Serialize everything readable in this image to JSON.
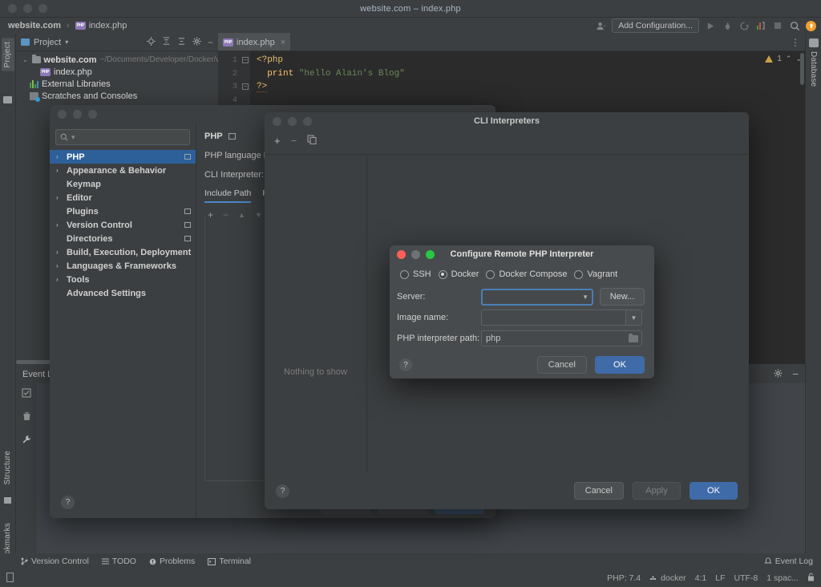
{
  "window": {
    "title": "website.com – index.php"
  },
  "navbar": {
    "project": "website.com",
    "separator": "›",
    "file": "index.php",
    "add_configuration": "Add Configuration...",
    "icons": [
      "profile-icon",
      "run-icon",
      "debug-icon",
      "run-coverage-icon",
      "profiler-icon",
      "stop-icon",
      "search-icon",
      "updates-icon"
    ]
  },
  "tool_windows": {
    "left_top": "Project",
    "left_bottom": [
      "Structure",
      "Bookmarks"
    ],
    "right": "Database"
  },
  "project_pane": {
    "title": "Project",
    "dropdown": "▾",
    "icons": [
      "locate-icon",
      "expand-all-icon",
      "collapse-all-icon",
      "settings-gear-icon",
      "hide-icon"
    ]
  },
  "project_tree": [
    {
      "label": "website.com",
      "path": "~/Documents/Developer/Docker/ww",
      "icon": "folder-icon",
      "arrow": "⌄",
      "bold": true,
      "indent": 0
    },
    {
      "label": "index.php",
      "path": "",
      "icon": "php-file-icon",
      "arrow": "",
      "bold": false,
      "indent": 1
    },
    {
      "label": "External Libraries",
      "path": "",
      "icon": "library-icon",
      "arrow": "",
      "bold": false,
      "indent": 0
    },
    {
      "label": "Scratches and Consoles",
      "path": "",
      "icon": "scratches-icon",
      "arrow": "",
      "bold": false,
      "indent": 0
    }
  ],
  "editor": {
    "tab": {
      "label": "index.php",
      "close": "×",
      "icon": "php-file-icon"
    },
    "kebab": "⋮",
    "lines": [
      "1",
      "2",
      "3",
      "4"
    ],
    "code": {
      "l1_open": "<?php",
      "l2_fn": "print",
      "l2_str": "\"hello Alain's Blog\"",
      "l3_close": "?>"
    },
    "warning_count": "1",
    "nav_up": "⌃",
    "nav_down": "⌄"
  },
  "event_log": {
    "title": "Event Log",
    "side_icons": [
      "mark-read-icon",
      "trash-icon",
      "wrench-icon"
    ],
    "header_icons": [
      "gear-icon",
      "minimize-icon"
    ]
  },
  "status_bar": {
    "items": [
      {
        "label": "Version Control",
        "icon": "branch-icon"
      },
      {
        "label": "TODO",
        "icon": "todo-icon"
      },
      {
        "label": "Problems",
        "icon": "problems-icon"
      },
      {
        "label": "Terminal",
        "icon": "terminal-icon"
      }
    ],
    "event_log": "Event Log",
    "event_log_icon": "bell-icon",
    "bottom": {
      "php_version": "PHP: 7.4",
      "interpreter": "docker",
      "caret": "4:1",
      "line_sep": "LF",
      "encoding": "UTF-8",
      "indent": "1 spac...",
      "lock_icon": "lock-icon",
      "left_icon": "memory-icon"
    }
  },
  "settings_dialog": {
    "search_placeholder": "",
    "search_icon": "search-icon",
    "tree": [
      {
        "label": "PHP",
        "arrow": "›",
        "selected": true,
        "mark": true
      },
      {
        "label": "Appearance & Behavior",
        "arrow": "›",
        "selected": false,
        "mark": false
      },
      {
        "label": "Keymap",
        "arrow": "",
        "selected": false,
        "mark": false
      },
      {
        "label": "Editor",
        "arrow": "›",
        "selected": false,
        "mark": false
      },
      {
        "label": "Plugins",
        "arrow": "",
        "selected": false,
        "mark": true
      },
      {
        "label": "Version Control",
        "arrow": "›",
        "selected": false,
        "mark": true
      },
      {
        "label": "Directories",
        "arrow": "",
        "selected": false,
        "mark": true
      },
      {
        "label": "Build, Execution, Deployment",
        "arrow": "›",
        "selected": false,
        "mark": false
      },
      {
        "label": "Languages & Frameworks",
        "arrow": "›",
        "selected": false,
        "mark": false
      },
      {
        "label": "Tools",
        "arrow": "›",
        "selected": false,
        "mark": false
      },
      {
        "label": "Advanced Settings",
        "arrow": "",
        "selected": false,
        "mark": false
      }
    ],
    "panel_title": "PHP",
    "panel_title_icon": "project-scope-icon",
    "field_language_level": "PHP language level:",
    "field_cli_interpreter": "CLI Interpreter:",
    "tabs": [
      {
        "label": "Include Path",
        "active": true
      },
      {
        "label": "PH",
        "active": false
      }
    ],
    "list_toolbar": [
      "add-icon",
      "remove-icon",
      "move-up-icon",
      "move-down-icon"
    ],
    "help": "?"
  },
  "cli_dialog": {
    "title": "CLI Interpreters",
    "toolbar": [
      "add-icon",
      "remove-icon",
      "copy-icon"
    ],
    "empty_message": "Nothing to show",
    "help": "?",
    "buttons": {
      "cancel": "Cancel",
      "apply": "Apply",
      "ok": "OK"
    }
  },
  "remote_dialog": {
    "title": "Configure Remote PHP Interpreter",
    "radios": [
      {
        "label": "SSH",
        "selected": false
      },
      {
        "label": "Docker",
        "selected": true
      },
      {
        "label": "Docker Compose",
        "selected": false
      },
      {
        "label": "Vagrant",
        "selected": false
      }
    ],
    "fields": [
      {
        "label": "Server:",
        "value": "",
        "type": "combo-focused"
      },
      {
        "label": "Image name:",
        "value": "",
        "type": "combo-split"
      },
      {
        "label": "PHP interpreter path:",
        "value": "php",
        "type": "text-browse"
      }
    ],
    "new_button": "New...",
    "help": "?",
    "buttons": {
      "cancel": "Cancel",
      "ok": "OK"
    }
  },
  "colors": {
    "accent_blue": "#2d6099",
    "button_blue": "#3f6ba8",
    "tab_underline": "#4a88c7",
    "focus_ring": "#4a7fb5",
    "bg": "#3c3f41",
    "editor_bg": "#2b2b2b",
    "string_green": "#6a8759",
    "keyword_orange": "#e8bf6a",
    "fn_yellow": "#ffc66d",
    "warn_yellow": "#c7a04a"
  }
}
